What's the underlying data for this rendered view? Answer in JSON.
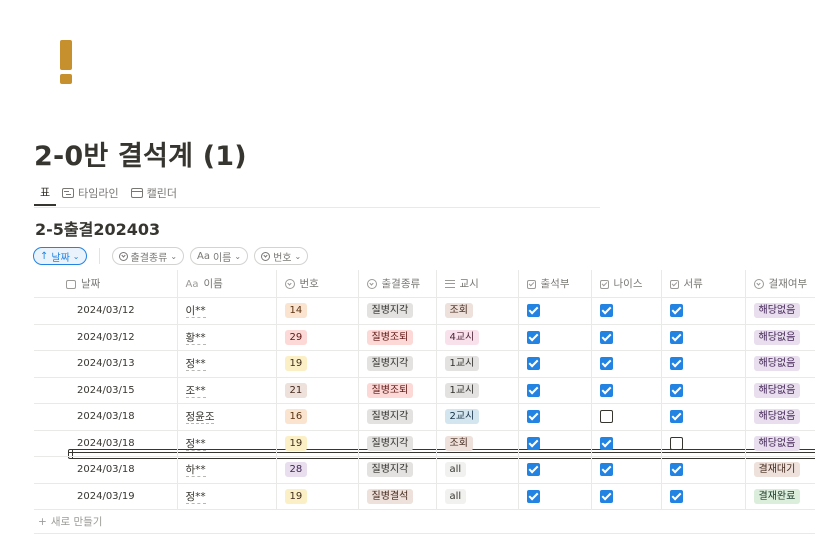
{
  "page": {
    "icon": "exclamation-icon",
    "title": "2-0반 결석계 (1)"
  },
  "views": [
    {
      "label": "표",
      "icon": "table-icon",
      "active": true
    },
    {
      "label": "타임라인",
      "icon": "timeline-icon",
      "active": false
    },
    {
      "label": "캘린더",
      "icon": "calendar-icon",
      "active": false
    }
  ],
  "database": {
    "title": "2-5출결202403"
  },
  "filters": {
    "sort_label": "날짜",
    "chips": [
      "출결종류",
      "이름",
      "번호"
    ]
  },
  "table": {
    "headers": {
      "date": "날짜",
      "name": "이름",
      "name_prefix": "Aa",
      "number": "번호",
      "type": "출결종류",
      "period": "교시",
      "attendance": "출석부",
      "nice": "나이스",
      "doc": "서류",
      "approval": "결재여부"
    },
    "rows": [
      {
        "date": "2024/03/12",
        "name": "이**",
        "number": "14",
        "type": "질병지각",
        "period": "조회",
        "attendance": true,
        "nice": true,
        "doc": true,
        "approval": "해당없음"
      },
      {
        "date": "2024/03/12",
        "name": "황**",
        "number": "29",
        "type": "질병조퇴",
        "period": "4교시",
        "attendance": true,
        "nice": true,
        "doc": true,
        "approval": "해당없음"
      },
      {
        "date": "2024/03/13",
        "name": "정**",
        "number": "19",
        "type": "질병지각",
        "period": "1교시",
        "attendance": true,
        "nice": true,
        "doc": true,
        "approval": "해당없음"
      },
      {
        "date": "2024/03/15",
        "name": "조**",
        "number": "21",
        "type": "질병조퇴",
        "period": "1교시",
        "attendance": true,
        "nice": true,
        "doc": true,
        "approval": "해당없음"
      },
      {
        "date": "2024/03/18",
        "name": "정윤조",
        "number": "16",
        "type": "질병지각",
        "period": "2교시",
        "attendance": true,
        "nice": false,
        "doc": true,
        "approval": "해당없음"
      },
      {
        "date": "2024/03/18",
        "name": "정**",
        "number": "19",
        "type": "질병지각",
        "period": "조회",
        "attendance": true,
        "nice": true,
        "doc": false,
        "approval": "해당없음"
      },
      {
        "date": "2024/03/18",
        "name": "하**",
        "number": "28",
        "type": "질병지각",
        "period": "all",
        "attendance": true,
        "nice": true,
        "doc": true,
        "approval": "결재대기"
      },
      {
        "date": "2024/03/19",
        "name": "정**",
        "number": "19",
        "type": "질병결석",
        "period": "all",
        "attendance": true,
        "nice": true,
        "doc": true,
        "approval": "결재완료"
      }
    ],
    "new_row_label": "새로 만들기"
  },
  "colors": {
    "accent": "#2383e2",
    "page_icon": "#c7902f"
  }
}
